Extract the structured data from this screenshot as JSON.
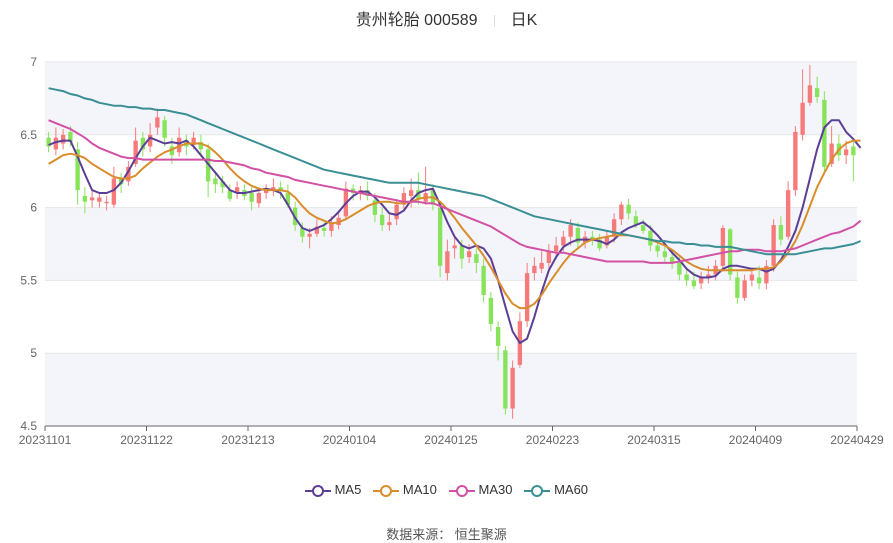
{
  "header": {
    "stock": "贵州轮胎 000589",
    "period": "日K"
  },
  "footer": {
    "source": "数据来源：  恒生聚源"
  },
  "chart_data": {
    "type": "candlestick",
    "ylim": [
      4.5,
      7.0
    ],
    "yticks": [
      4.5,
      5,
      5.5,
      6,
      6.5,
      7
    ],
    "ytick_labels": [
      "4.5",
      "5",
      "5.5",
      "6",
      "6.5",
      "7"
    ],
    "x_tick_labels": [
      "20231101",
      "20231122",
      "20231213",
      "20240104",
      "20240125",
      "20240223",
      "20240315",
      "20240409",
      "20240429"
    ],
    "legend": [
      {
        "name": "MA5",
        "color": "#5b3e96"
      },
      {
        "name": "MA10",
        "color": "#d98c2b"
      },
      {
        "name": "MA30",
        "color": "#d251a4"
      },
      {
        "name": "MA60",
        "color": "#3a8f94"
      }
    ],
    "candles": [
      [
        6.48,
        6.42,
        6.52,
        6.38
      ],
      [
        6.4,
        6.48,
        6.55,
        6.36
      ],
      [
        6.44,
        6.5,
        6.54,
        6.4
      ],
      [
        6.52,
        6.45,
        6.56,
        6.42
      ],
      [
        6.4,
        6.12,
        6.45,
        6.02
      ],
      [
        6.08,
        6.04,
        6.14,
        5.96
      ],
      [
        6.05,
        6.07,
        6.12,
        6.0
      ],
      [
        6.04,
        6.07,
        6.1,
        6.0
      ],
      [
        6.03,
        6.04,
        6.08,
        5.98
      ],
      [
        6.02,
        6.2,
        6.28,
        6.0
      ],
      [
        6.2,
        6.16,
        6.24,
        6.1
      ],
      [
        6.18,
        6.28,
        6.32,
        6.15
      ],
      [
        6.3,
        6.46,
        6.55,
        6.28
      ],
      [
        6.48,
        6.4,
        6.52,
        6.35
      ],
      [
        6.42,
        6.5,
        6.58,
        6.38
      ],
      [
        6.55,
        6.62,
        6.68,
        6.5
      ],
      [
        6.6,
        6.48,
        6.63,
        6.42
      ],
      [
        6.42,
        6.36,
        6.48,
        6.3
      ],
      [
        6.38,
        6.48,
        6.55,
        6.35
      ],
      [
        6.46,
        6.42,
        6.5,
        6.36
      ],
      [
        6.43,
        6.48,
        6.52,
        6.4
      ],
      [
        6.45,
        6.4,
        6.5,
        6.35
      ],
      [
        6.4,
        6.18,
        6.44,
        6.07
      ],
      [
        6.2,
        6.16,
        6.25,
        6.1
      ],
      [
        6.18,
        6.14,
        6.22,
        6.1
      ],
      [
        6.12,
        6.06,
        6.16,
        6.04
      ],
      [
        6.1,
        6.14,
        6.18,
        6.06
      ],
      [
        6.12,
        6.08,
        6.16,
        6.05
      ],
      [
        6.1,
        6.04,
        6.14,
        5.98
      ],
      [
        6.03,
        6.1,
        6.14,
        6.0
      ],
      [
        6.1,
        6.12,
        6.16,
        6.06
      ],
      [
        6.12,
        6.14,
        6.2,
        6.08
      ],
      [
        6.14,
        6.12,
        6.18,
        6.06
      ],
      [
        6.1,
        6.02,
        6.16,
        6.0
      ],
      [
        6.0,
        5.88,
        6.04,
        5.84
      ],
      [
        5.86,
        5.8,
        5.9,
        5.76
      ],
      [
        5.8,
        5.82,
        5.86,
        5.72
      ],
      [
        5.82,
        5.87,
        5.92,
        5.8
      ],
      [
        5.86,
        5.84,
        5.9,
        5.8
      ],
      [
        5.84,
        5.9,
        5.94,
        5.8
      ],
      [
        5.88,
        5.93,
        5.98,
        5.85
      ],
      [
        5.94,
        6.13,
        6.18,
        5.92
      ],
      [
        6.13,
        6.1,
        6.16,
        6.05
      ],
      [
        6.1,
        6.12,
        6.15,
        6.05
      ],
      [
        6.12,
        6.08,
        6.18,
        6.05
      ],
      [
        6.05,
        5.95,
        6.1,
        5.9
      ],
      [
        5.95,
        5.88,
        6.0,
        5.84
      ],
      [
        5.88,
        5.9,
        5.95,
        5.84
      ],
      [
        5.92,
        6.02,
        6.06,
        5.88
      ],
      [
        6.02,
        6.1,
        6.14,
        5.98
      ],
      [
        6.08,
        6.12,
        6.2,
        6.0
      ],
      [
        6.12,
        6.06,
        6.24,
        6.02
      ],
      [
        6.04,
        6.1,
        6.28,
        6.02
      ],
      [
        6.12,
        6.02,
        6.16,
        5.98
      ],
      [
        6.0,
        5.6,
        6.04,
        5.52
      ],
      [
        5.55,
        5.7,
        5.78,
        5.5
      ],
      [
        5.72,
        5.74,
        5.8,
        5.65
      ],
      [
        5.74,
        5.65,
        5.78,
        5.58
      ],
      [
        5.66,
        5.7,
        5.75,
        5.62
      ],
      [
        5.68,
        5.62,
        5.72,
        5.55
      ],
      [
        5.6,
        5.4,
        5.65,
        5.35
      ],
      [
        5.38,
        5.2,
        5.42,
        5.15
      ],
      [
        5.18,
        5.05,
        5.22,
        4.95
      ],
      [
        5.02,
        4.62,
        5.05,
        4.58
      ],
      [
        4.62,
        4.9,
        4.95,
        4.55
      ],
      [
        4.92,
        5.22,
        5.28,
        4.9
      ],
      [
        5.22,
        5.55,
        5.62,
        5.18
      ],
      [
        5.55,
        5.6,
        5.66,
        5.5
      ],
      [
        5.58,
        5.62,
        5.7,
        5.55
      ],
      [
        5.62,
        5.7,
        5.75,
        5.58
      ],
      [
        5.7,
        5.74,
        5.8,
        5.65
      ],
      [
        5.74,
        5.8,
        5.84,
        5.7
      ],
      [
        5.8,
        5.88,
        5.92,
        5.74
      ],
      [
        5.86,
        5.76,
        5.9,
        5.72
      ],
      [
        5.76,
        5.8,
        5.84,
        5.72
      ],
      [
        5.8,
        5.78,
        5.84,
        5.74
      ],
      [
        5.78,
        5.72,
        5.82,
        5.7
      ],
      [
        5.74,
        5.8,
        5.84,
        5.72
      ],
      [
        5.8,
        5.92,
        5.96,
        5.76
      ],
      [
        5.92,
        6.02,
        6.04,
        5.88
      ],
      [
        6.02,
        5.96,
        6.06,
        5.92
      ],
      [
        5.94,
        5.88,
        5.98,
        5.86
      ],
      [
        5.88,
        5.84,
        5.92,
        5.82
      ],
      [
        5.84,
        5.74,
        5.88,
        5.7
      ],
      [
        5.74,
        5.7,
        5.78,
        5.66
      ],
      [
        5.7,
        5.66,
        5.74,
        5.62
      ],
      [
        5.66,
        5.62,
        5.7,
        5.58
      ],
      [
        5.62,
        5.54,
        5.66,
        5.5
      ],
      [
        5.54,
        5.5,
        5.58,
        5.46
      ],
      [
        5.5,
        5.46,
        5.56,
        5.44
      ],
      [
        5.48,
        5.52,
        5.56,
        5.44
      ],
      [
        5.52,
        5.54,
        5.6,
        5.48
      ],
      [
        5.54,
        5.6,
        5.64,
        5.5
      ],
      [
        5.6,
        5.86,
        5.88,
        5.56
      ],
      [
        5.85,
        5.54,
        5.86,
        5.5
      ],
      [
        5.52,
        5.38,
        5.56,
        5.34
      ],
      [
        5.38,
        5.5,
        5.54,
        5.36
      ],
      [
        5.5,
        5.54,
        5.58,
        5.46
      ],
      [
        5.52,
        5.48,
        5.6,
        5.44
      ],
      [
        5.48,
        5.6,
        5.64,
        5.44
      ],
      [
        5.6,
        5.88,
        5.92,
        5.56
      ],
      [
        5.88,
        5.78,
        5.94,
        5.74
      ],
      [
        5.8,
        6.12,
        6.18,
        5.78
      ],
      [
        6.12,
        6.52,
        6.56,
        6.08
      ],
      [
        6.5,
        6.72,
        6.95,
        6.46
      ],
      [
        6.72,
        6.84,
        6.98,
        6.7
      ],
      [
        6.82,
        6.76,
        6.9,
        6.72
      ],
      [
        6.74,
        6.28,
        6.8,
        6.24
      ],
      [
        6.3,
        6.44,
        6.56,
        6.28
      ],
      [
        6.44,
        6.36,
        6.5,
        6.32
      ],
      [
        6.36,
        6.4,
        6.46,
        6.3
      ],
      [
        6.42,
        6.36,
        6.48,
        6.18
      ]
    ],
    "ma5": [
      6.43,
      6.45,
      6.46,
      6.46,
      6.35,
      6.23,
      6.12,
      6.1,
      6.1,
      6.12,
      6.17,
      6.25,
      6.34,
      6.42,
      6.48,
      6.46,
      6.44,
      6.45,
      6.44,
      6.46,
      6.42,
      6.36,
      6.3,
      6.24,
      6.18,
      6.12,
      6.1,
      6.1,
      6.11,
      6.12,
      6.13,
      6.12,
      6.1,
      6.02,
      5.93,
      5.86,
      5.84,
      5.86,
      5.88,
      5.92,
      5.97,
      6.03,
      6.08,
      6.11,
      6.11,
      6.07,
      6.02,
      5.96,
      5.95,
      5.98,
      6.05,
      6.1,
      6.12,
      6.13,
      6.02,
      5.9,
      5.8,
      5.74,
      5.72,
      5.74,
      5.72,
      5.65,
      5.5,
      5.32,
      5.15,
      5.07,
      5.1,
      5.25,
      5.42,
      5.57,
      5.66,
      5.73,
      5.76,
      5.78,
      5.78,
      5.78,
      5.77,
      5.75,
      5.78,
      5.83,
      5.86,
      5.88,
      5.9,
      5.86,
      5.81,
      5.75,
      5.69,
      5.64,
      5.58,
      5.54,
      5.52,
      5.52,
      5.53,
      5.58,
      5.6,
      5.6,
      5.59,
      5.58,
      5.58,
      5.56,
      5.58,
      5.64,
      5.73,
      5.84,
      6.0,
      6.2,
      6.4,
      6.55,
      6.6,
      6.6,
      6.52,
      6.47,
      6.41
    ],
    "ma10": [
      6.3,
      6.33,
      6.36,
      6.37,
      6.36,
      6.34,
      6.3,
      6.27,
      6.24,
      6.21,
      6.2,
      6.2,
      6.22,
      6.27,
      6.31,
      6.35,
      6.38,
      6.4,
      6.42,
      6.44,
      6.44,
      6.44,
      6.42,
      6.38,
      6.33,
      6.27,
      6.22,
      6.18,
      6.15,
      6.13,
      6.12,
      6.12,
      6.12,
      6.11,
      6.07,
      6.01,
      5.96,
      5.93,
      5.91,
      5.89,
      5.9,
      5.92,
      5.95,
      5.98,
      6.01,
      6.03,
      6.04,
      6.04,
      6.03,
      6.03,
      6.04,
      6.06,
      6.07,
      6.07,
      6.04,
      5.99,
      5.93,
      5.86,
      5.8,
      5.74,
      5.67,
      5.59,
      5.5,
      5.41,
      5.34,
      5.31,
      5.31,
      5.34,
      5.4,
      5.48,
      5.55,
      5.62,
      5.68,
      5.72,
      5.76,
      5.78,
      5.79,
      5.8,
      5.81,
      5.81,
      5.81,
      5.8,
      5.79,
      5.78,
      5.76,
      5.74,
      5.71,
      5.67,
      5.63,
      5.6,
      5.58,
      5.57,
      5.57,
      5.57,
      5.57,
      5.57,
      5.57,
      5.57,
      5.58,
      5.58,
      5.59,
      5.63,
      5.69,
      5.77,
      5.88,
      6.01,
      6.14,
      6.24,
      6.33,
      6.4,
      6.44,
      6.46,
      6.46
    ],
    "ma30": [
      6.6,
      6.58,
      6.56,
      6.54,
      6.51,
      6.48,
      6.44,
      6.41,
      6.39,
      6.37,
      6.35,
      6.34,
      6.34,
      6.33,
      6.33,
      6.33,
      6.33,
      6.33,
      6.33,
      6.33,
      6.33,
      6.33,
      6.33,
      6.32,
      6.32,
      6.31,
      6.3,
      6.29,
      6.27,
      6.26,
      6.24,
      6.23,
      6.22,
      6.21,
      6.19,
      6.18,
      6.17,
      6.16,
      6.15,
      6.14,
      6.13,
      6.12,
      6.11,
      6.1,
      6.09,
      6.08,
      6.07,
      6.06,
      6.05,
      6.04,
      6.04,
      6.04,
      6.03,
      6.03,
      6.01,
      5.99,
      5.97,
      5.95,
      5.93,
      5.91,
      5.89,
      5.87,
      5.84,
      5.81,
      5.78,
      5.75,
      5.73,
      5.72,
      5.71,
      5.7,
      5.69,
      5.69,
      5.68,
      5.67,
      5.66,
      5.65,
      5.64,
      5.63,
      5.63,
      5.63,
      5.63,
      5.63,
      5.63,
      5.62,
      5.62,
      5.62,
      5.62,
      5.63,
      5.64,
      5.65,
      5.66,
      5.67,
      5.68,
      5.69,
      5.7,
      5.7,
      5.71,
      5.71,
      5.71,
      5.7,
      5.7,
      5.7,
      5.71,
      5.72,
      5.74,
      5.76,
      5.78,
      5.8,
      5.82,
      5.83,
      5.85,
      5.87,
      5.91
    ],
    "ma60": [
      6.82,
      6.81,
      6.8,
      6.78,
      6.77,
      6.75,
      6.74,
      6.72,
      6.71,
      6.7,
      6.7,
      6.69,
      6.69,
      6.68,
      6.68,
      6.67,
      6.67,
      6.66,
      6.65,
      6.64,
      6.62,
      6.6,
      6.58,
      6.56,
      6.54,
      6.52,
      6.5,
      6.48,
      6.46,
      6.44,
      6.42,
      6.4,
      6.38,
      6.36,
      6.34,
      6.32,
      6.3,
      6.28,
      6.26,
      6.25,
      6.24,
      6.23,
      6.22,
      6.21,
      6.2,
      6.19,
      6.18,
      6.17,
      6.17,
      6.17,
      6.17,
      6.17,
      6.16,
      6.15,
      6.14,
      6.13,
      6.12,
      6.11,
      6.1,
      6.09,
      6.08,
      6.06,
      6.04,
      6.02,
      6.0,
      5.98,
      5.96,
      5.94,
      5.93,
      5.92,
      5.91,
      5.9,
      5.89,
      5.88,
      5.87,
      5.86,
      5.85,
      5.84,
      5.83,
      5.82,
      5.81,
      5.8,
      5.79,
      5.78,
      5.77,
      5.77,
      5.76,
      5.76,
      5.75,
      5.75,
      5.74,
      5.74,
      5.73,
      5.73,
      5.73,
      5.72,
      5.71,
      5.7,
      5.69,
      5.68,
      5.68,
      5.68,
      5.68,
      5.68,
      5.69,
      5.7,
      5.71,
      5.72,
      5.72,
      5.73,
      5.74,
      5.75,
      5.77
    ]
  }
}
